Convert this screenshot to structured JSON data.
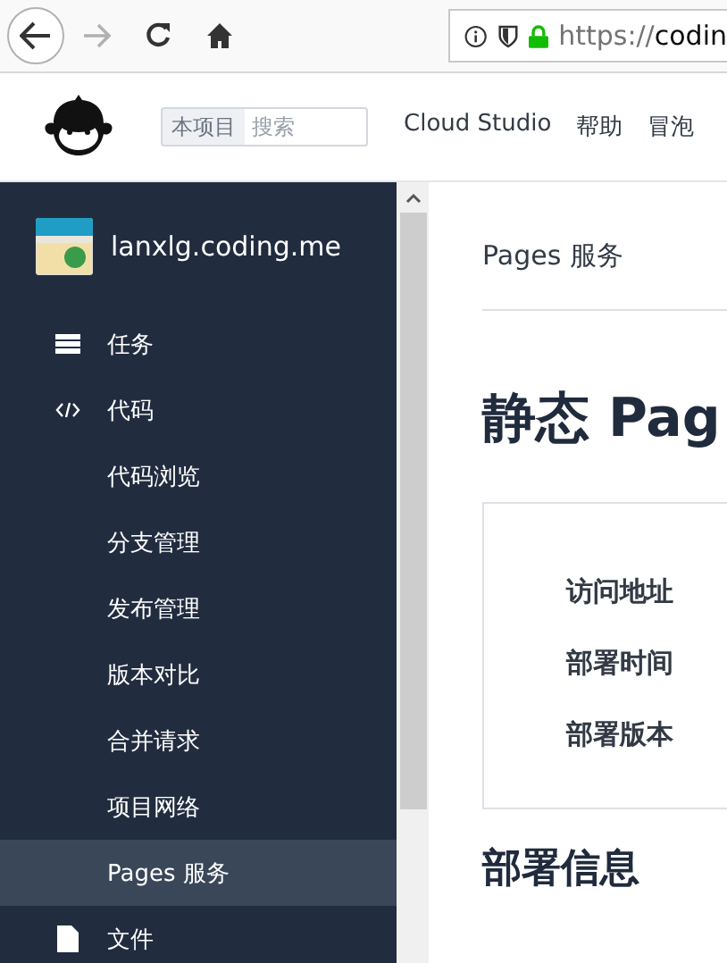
{
  "browser": {
    "url_scheme": "https://",
    "url_host": "codin",
    "forward_disabled": true
  },
  "header": {
    "search": {
      "scope": "本项目",
      "placeholder": "搜索"
    },
    "nav": [
      "Cloud Studio",
      "帮助",
      "冒泡"
    ]
  },
  "sidebar": {
    "project": "lanxlg.coding.me",
    "items": [
      {
        "kind": "tasks",
        "label": "任务",
        "selected": false
      },
      {
        "kind": "code",
        "label": "代码",
        "selected": false,
        "children": [
          {
            "label": "代码浏览",
            "selected": false
          },
          {
            "label": "分支管理",
            "selected": false
          },
          {
            "label": "发布管理",
            "selected": false
          },
          {
            "label": "版本对比",
            "selected": false
          },
          {
            "label": "合并请求",
            "selected": false
          },
          {
            "label": "项目网络",
            "selected": false
          },
          {
            "label": "Pages 服务",
            "selected": true
          }
        ]
      },
      {
        "kind": "file",
        "label": "文件",
        "selected": false
      }
    ]
  },
  "content": {
    "breadcrumb": "Pages 服务",
    "title": "静态 Pag",
    "fields": [
      "访问地址",
      "部署时间",
      "部署版本"
    ],
    "section": "部署信息"
  }
}
